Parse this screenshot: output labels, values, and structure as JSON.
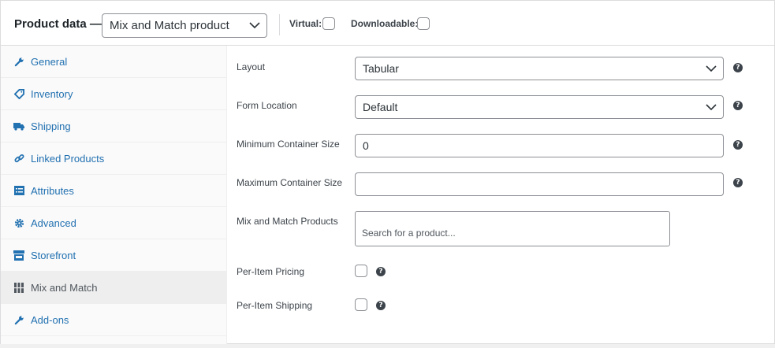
{
  "header": {
    "title": "Product data —",
    "product_type": "Mix and Match product",
    "virtual_label": "Virtual:",
    "downloadable_label": "Downloadable:"
  },
  "sidebar": {
    "items": [
      {
        "label": "General",
        "icon": "wrench-icon"
      },
      {
        "label": "Inventory",
        "icon": "tag-icon"
      },
      {
        "label": "Shipping",
        "icon": "truck-icon"
      },
      {
        "label": "Linked Products",
        "icon": "link-icon"
      },
      {
        "label": "Attributes",
        "icon": "list-icon"
      },
      {
        "label": "Advanced",
        "icon": "gear-icon"
      },
      {
        "label": "Storefront",
        "icon": "store-icon"
      },
      {
        "label": "Mix and Match",
        "icon": "grid-icon",
        "active": true
      },
      {
        "label": "Add-ons",
        "icon": "wrench-icon"
      }
    ]
  },
  "fields": {
    "layout": {
      "label": "Layout",
      "value": "Tabular"
    },
    "form_location": {
      "label": "Form Location",
      "value": "Default"
    },
    "min_size": {
      "label": "Minimum Container Size",
      "value": "0"
    },
    "max_size": {
      "label": "Maximum Container Size",
      "value": ""
    },
    "products": {
      "label": "Mix and Match Products",
      "placeholder": "Search for a product..."
    },
    "per_item_pricing": {
      "label": "Per-Item Pricing",
      "checked": false
    },
    "per_item_shipping": {
      "label": "Per-Item Shipping",
      "checked": false
    }
  },
  "help_glyph": "?",
  "colors": {
    "link": "#2271b1",
    "active_bg": "#eeeeee",
    "border": "#8c8f94"
  }
}
